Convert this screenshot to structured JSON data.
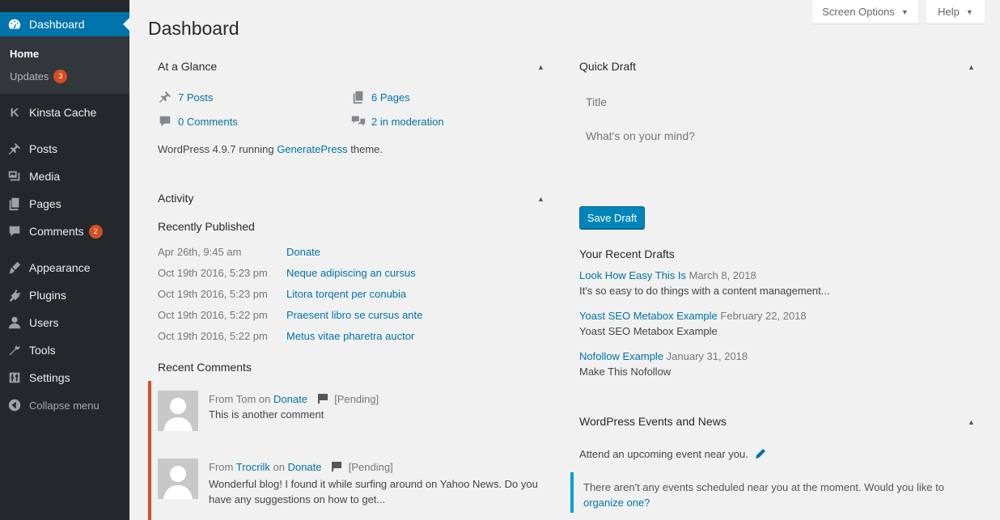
{
  "sidebar": {
    "dashboard_label": "Dashboard",
    "sub": {
      "home": "Home",
      "updates": "Updates",
      "updates_count": "3"
    },
    "kinsta": "Kinsta Cache",
    "posts": "Posts",
    "media": "Media",
    "pages": "Pages",
    "comments": "Comments",
    "comments_count": "2",
    "appearance": "Appearance",
    "plugins": "Plugins",
    "users": "Users",
    "tools": "Tools",
    "settings": "Settings",
    "collapse": "Collapse menu"
  },
  "screen_meta": {
    "screen_options": "Screen Options",
    "help": "Help"
  },
  "page_title": "Dashboard",
  "glance": {
    "title": "At a Glance",
    "posts": "7 Posts",
    "pages": "6 Pages",
    "comments": "0 Comments",
    "moderation": "2 in moderation",
    "running_pre": "WordPress 4.9.7 running",
    "theme": "GeneratePress",
    "running_post": "theme."
  },
  "activity": {
    "title": "Activity",
    "recently_published": "Recently Published",
    "items": [
      {
        "date": "Apr 26th, 9:45 am",
        "title": "Donate"
      },
      {
        "date": "Oct 19th 2016, 5:23 pm",
        "title": "Neque adipiscing an cursus"
      },
      {
        "date": "Oct 19th 2016, 5:23 pm",
        "title": "Litora torqent per conubia"
      },
      {
        "date": "Oct 19th 2016, 5:22 pm",
        "title": "Praesent libro se cursus ante"
      },
      {
        "date": "Oct 19th 2016, 5:22 pm",
        "title": "Metus vitae pharetra auctor"
      }
    ],
    "recent_comments": "Recent Comments",
    "comments": [
      {
        "from": "From",
        "author": "Tom",
        "on": "on",
        "post": "Donate",
        "status": "[Pending]",
        "text": "This is another comment"
      },
      {
        "from": "From",
        "author": "Trocrilk",
        "on": "on",
        "post": "Donate",
        "status": "[Pending]",
        "text": "Wonderful blog! I found it while surfing around on Yahoo News. Do you have any suggestions on how to get..."
      }
    ]
  },
  "quick_draft": {
    "title": "Quick Draft",
    "title_placeholder": "Title",
    "content_placeholder": "What's on your mind?",
    "save_label": "Save Draft",
    "recent_drafts": "Your Recent Drafts",
    "drafts": [
      {
        "title": "Look How Easy This Is",
        "date": "March 8, 2018",
        "excerpt": "It's so easy to do things with a content management..."
      },
      {
        "title": "Yoast SEO Metabox Example",
        "date": "February 22, 2018",
        "excerpt": "Yoast SEO Metabox Example"
      },
      {
        "title": "Nofollow Example",
        "date": "January 31, 2018",
        "excerpt": "Make This Nofollow"
      }
    ]
  },
  "events": {
    "title": "WordPress Events and News",
    "attend": "Attend an upcoming event near you.",
    "notice_text": "There aren't any events scheduled near you at the moment. Would you like to",
    "notice_link": "organize one?"
  },
  "colors": {
    "accent": "#0073aa",
    "sidebar": "#23282d",
    "badge": "#d54e21",
    "pending_border": "#d54e21",
    "notice_border": "#00a0d2"
  }
}
